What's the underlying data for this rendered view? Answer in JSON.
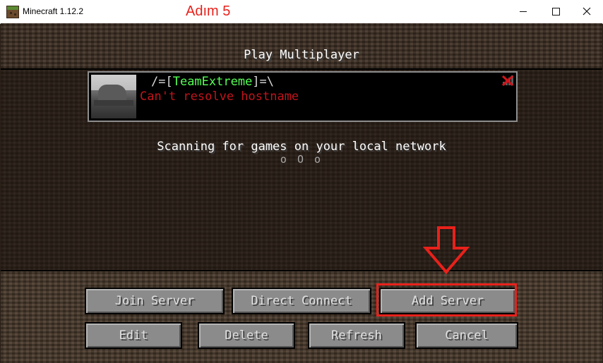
{
  "window": {
    "title": "Minecraft 1.12.2",
    "annotation": "Adım 5",
    "annotation_color": "#e8211b",
    "app_icon": "minecraft-grass-block-icon"
  },
  "screen": {
    "title": "Play Multiplayer"
  },
  "server_list": [
    {
      "name_prefix": "/=[",
      "name_highlight": "TeamExtreme",
      "name_suffix": "]=\\",
      "status": "Can't resolve hostname",
      "status_color": "#c2141b",
      "ping_icon": "no-connection-icon"
    }
  ],
  "lan_scan": {
    "text": "Scanning for games on your local network",
    "dots": "o O o"
  },
  "buttons": {
    "join_server": "Join Server",
    "direct_connect": "Direct Connect",
    "add_server": "Add Server",
    "edit": "Edit",
    "delete": "Delete",
    "refresh": "Refresh",
    "cancel": "Cancel"
  },
  "annotation_arrow": "down-arrow-icon"
}
